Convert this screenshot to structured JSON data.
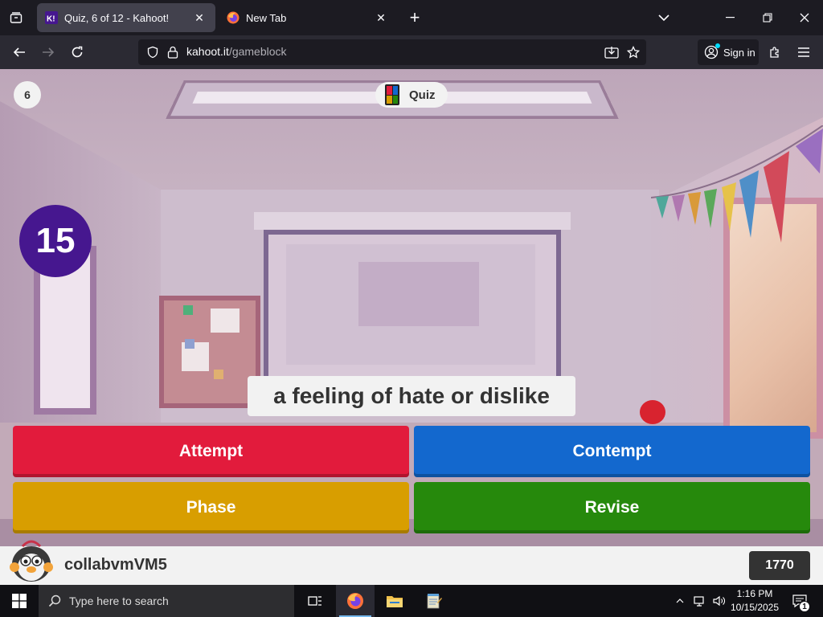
{
  "browser": {
    "tabs": [
      {
        "title": "Quiz, 6 of 12 - Kahoot!",
        "active": true
      },
      {
        "title": "New Tab",
        "active": false
      }
    ],
    "url_host": "kahoot.it",
    "url_path": "/gameblock",
    "sign_in_label": "Sign in"
  },
  "game": {
    "question_number": "6",
    "mode_label": "Quiz",
    "timer": "15",
    "question": "a feeling of hate or dislike",
    "answers": [
      {
        "label": "Attempt",
        "color": "#e21b3c"
      },
      {
        "label": "Contempt",
        "color": "#1368ce"
      },
      {
        "label": "Phase",
        "color": "#d89e00"
      },
      {
        "label": "Revise",
        "color": "#26890c"
      }
    ]
  },
  "player": {
    "name": "collabvmVM5",
    "score": "1770"
  },
  "taskbar": {
    "search_placeholder": "Type here to search",
    "time": "1:16 PM",
    "date": "10/15/2025",
    "notification_count": "1"
  },
  "colors": {
    "timer_bg": "#46178f",
    "kahoot_purple": "#46178f"
  }
}
